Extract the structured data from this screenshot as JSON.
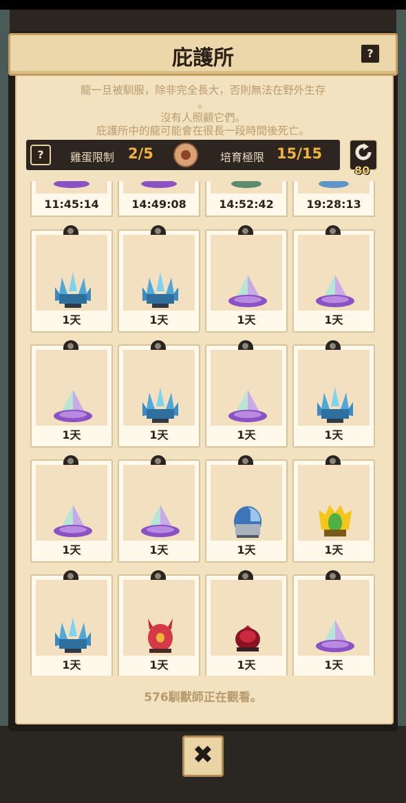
{
  "header": {
    "title": "庇護所",
    "help": "?"
  },
  "description": {
    "line1": "龍一旦被馴服，除非完全長大，否則無法在野外生存",
    "line2": "。",
    "line3": "沒有人照顧它們。",
    "line4": "庇護所中的龍可能會在很長一段時間後死亡。"
  },
  "info": {
    "help": "?",
    "egg_label": "雞蛋限制",
    "egg_value": "2/5",
    "breed_label": "培育極限",
    "breed_value": "15/15",
    "refresh_count": "80"
  },
  "top_row": [
    {
      "time": "11:45:14",
      "egg": "purple-crystal-egg"
    },
    {
      "time": "14:49:08",
      "egg": "purple-crystal-egg"
    },
    {
      "time": "14:52:42",
      "egg": "green-egg"
    },
    {
      "time": "19:28:13",
      "egg": "blue-egg"
    }
  ],
  "cards": [
    {
      "label": "1天",
      "egg": "ice-crystal-egg"
    },
    {
      "label": "1天",
      "egg": "ice-crystal-egg"
    },
    {
      "label": "1天",
      "egg": "prism-egg"
    },
    {
      "label": "1天",
      "egg": "prism-egg"
    },
    {
      "label": "1天",
      "egg": "prism-egg"
    },
    {
      "label": "1天",
      "egg": "ice-crystal-egg"
    },
    {
      "label": "1天",
      "egg": "prism-egg"
    },
    {
      "label": "1天",
      "egg": "ice-crystal-egg"
    },
    {
      "label": "1天",
      "egg": "prism-egg"
    },
    {
      "label": "1天",
      "egg": "prism-egg"
    },
    {
      "label": "1天",
      "egg": "steel-egg"
    },
    {
      "label": "1天",
      "egg": "golden-spike-egg"
    },
    {
      "label": "1天",
      "egg": "ice-crystal-egg"
    },
    {
      "label": "1天",
      "egg": "red-horned-egg"
    },
    {
      "label": "1天",
      "egg": "dark-red-egg"
    },
    {
      "label": "1天",
      "egg": "prism-egg"
    }
  ],
  "footer": {
    "watching": "576馴獸師正在觀看。",
    "close": "✖"
  }
}
